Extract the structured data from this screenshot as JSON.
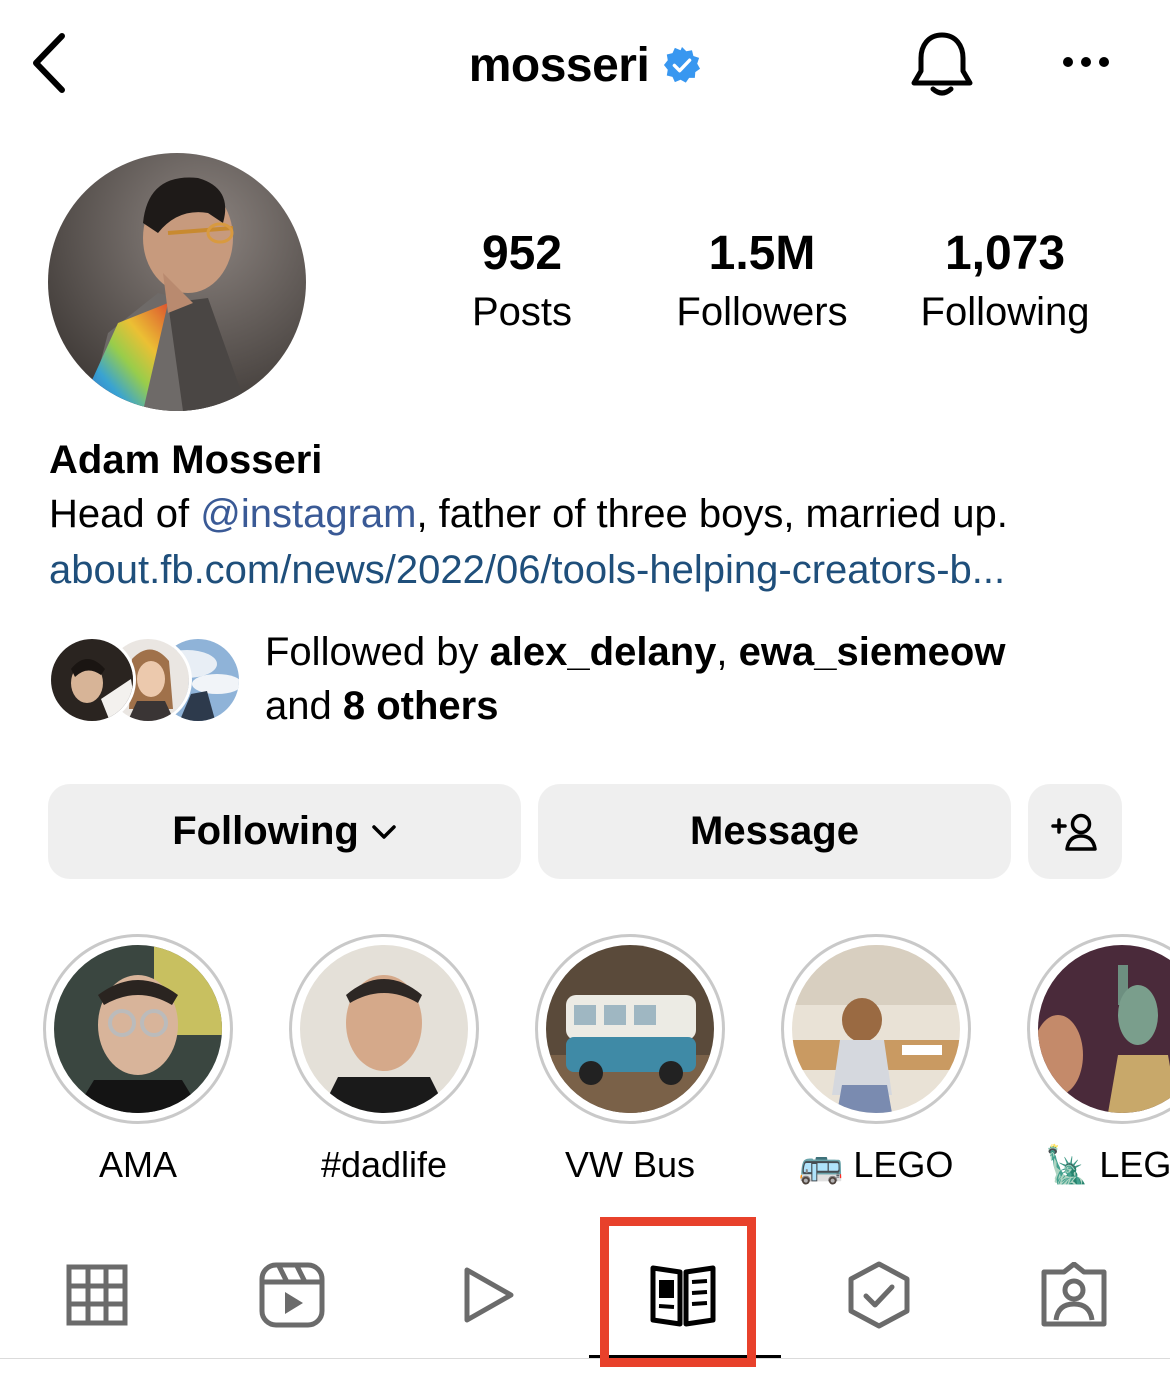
{
  "header": {
    "username": "mosseri"
  },
  "stats": {
    "posts_count": "952",
    "posts_label": "Posts",
    "followers_count": "1.5M",
    "followers_label": "Followers",
    "following_count": "1,073",
    "following_label": "Following"
  },
  "bio": {
    "full_name": "Adam Mosseri",
    "line_prefix": "Head of ",
    "mention": "@instagram",
    "line_suffix": ", father of three boys, married up.",
    "link": "about.fb.com/news/2022/06/tools-helping-creators-b..."
  },
  "followed_by": {
    "prefix": "Followed by ",
    "user1": "alex_delany",
    "separator": ", ",
    "user2": "ewa_siemeow",
    "and_text": "and ",
    "others": "8 others"
  },
  "actions": {
    "following_label": "Following",
    "message_label": "Message"
  },
  "highlights": [
    {
      "label": "AMA"
    },
    {
      "label": "#dadlife"
    },
    {
      "label": "VW Bus"
    },
    {
      "label": "🚌 LEGO"
    },
    {
      "label": "🗽 LEGO"
    }
  ],
  "tabs": [
    {
      "icon": "grid-icon"
    },
    {
      "icon": "reels-icon"
    },
    {
      "icon": "play-icon"
    },
    {
      "icon": "guides-icon"
    },
    {
      "icon": "verified-check-icon"
    },
    {
      "icon": "tagged-icon"
    }
  ],
  "colors": {
    "verified_blue": "#3897f0",
    "link_blue": "#1f4f7b",
    "button_gray": "#efefef",
    "annotation_red": "#e8412b"
  }
}
